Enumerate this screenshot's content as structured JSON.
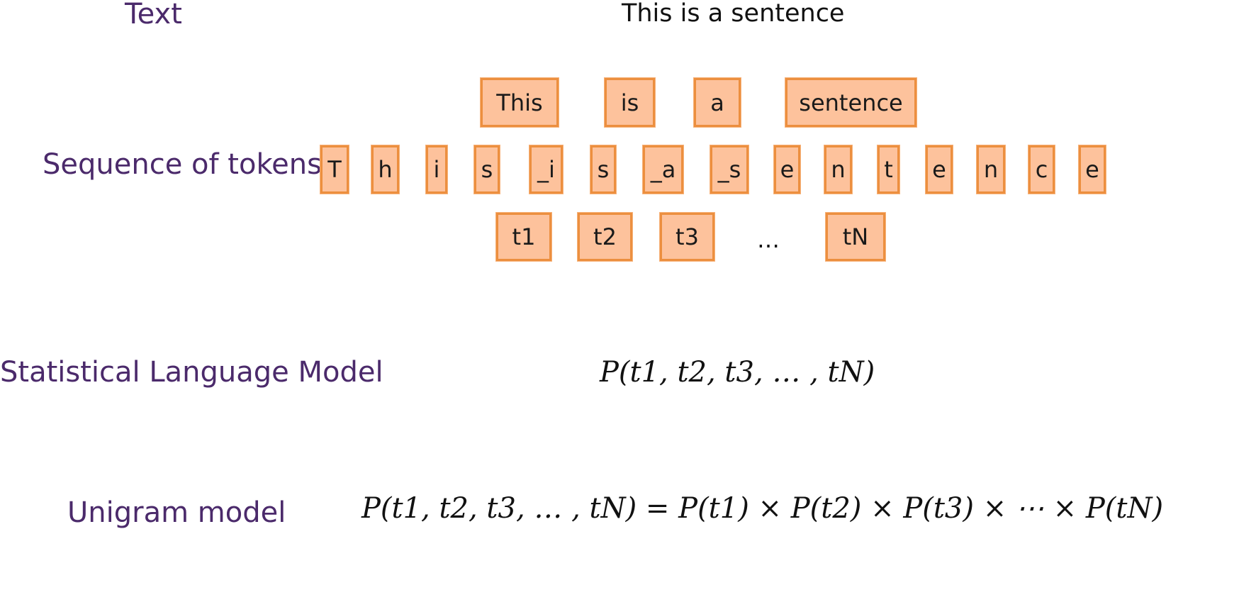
{
  "labels": {
    "text": "Text",
    "sequence": "Sequence of tokens",
    "statistical": "Statistical Language Model",
    "unigram": "Unigram model"
  },
  "sentence": "This is a sentence",
  "word_tokens": [
    "This",
    "is",
    "a",
    "sentence"
  ],
  "char_tokens": [
    "T",
    "h",
    "i",
    "s",
    "_i",
    "s",
    "_a",
    "_s",
    "e",
    "n",
    "t",
    "e",
    "n",
    "c",
    "e"
  ],
  "generic_tokens": [
    "t1",
    "t2",
    "t3",
    "tN"
  ],
  "generic_ellipsis": "…",
  "formulas": {
    "joint": "P(t1, t2, t3, … , tN)",
    "unigram": "P(t1, t2, t3, … , tN) = P(t1)  × P(t2) × P(t3)  × ⋯ × P(tN)"
  },
  "colors": {
    "label_purple": "#4b2a6b",
    "box_fill": "#fdc29c",
    "box_border": "#ec8f3f"
  }
}
